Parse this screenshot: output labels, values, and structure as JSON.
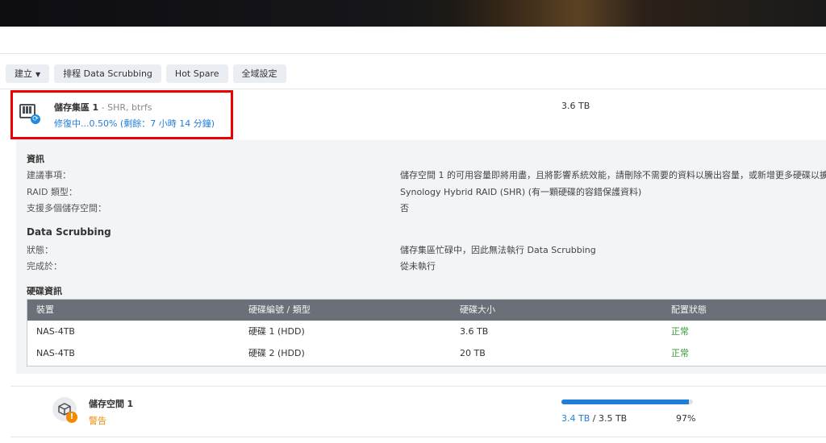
{
  "toolbar": {
    "create_label": "建立",
    "schedule_label": "排程 Data Scrubbing",
    "hotspare_label": "Hot Spare",
    "global_label": "全域設定"
  },
  "pool": {
    "name": "儲存集區",
    "index": "1",
    "fs": " - SHR, btrfs",
    "status": "修復中...0.50% (剩餘：7 小時 14 分鐘)",
    "size": "3.6 TB"
  },
  "info": {
    "title": "資訊",
    "rows": [
      {
        "label": "建議事項：",
        "value": "儲存空間 1 的可用容量即將用盡，且將影響系統效能，請刪除不需要的資料以騰出容量，或新增更多硬碟以擴充"
      },
      {
        "label": "RAID 類型：",
        "value": "Synology Hybrid RAID (SHR) (有一顆硬碟的容錯保護資料)"
      },
      {
        "label": "支援多個儲存空間：",
        "value": "否"
      }
    ]
  },
  "scrubbing": {
    "title": "Data Scrubbing",
    "rows": [
      {
        "label": "狀態：",
        "value": "儲存集區忙碌中，因此無法執行 Data Scrubbing"
      },
      {
        "label": "完成於：",
        "value": "從未執行"
      }
    ]
  },
  "disks": {
    "title": "硬碟資訊",
    "headers": [
      "裝置",
      "硬碟編號 / 類型",
      "硬碟大小",
      "配置狀態"
    ],
    "rows": [
      [
        "NAS-4TB",
        "硬碟 1 (HDD)",
        "3.6 TB",
        "正常"
      ],
      [
        "NAS-4TB",
        "硬碟 2 (HDD)",
        "20 TB",
        "正常"
      ]
    ]
  },
  "volume": {
    "name": "儲存空間",
    "index": "1",
    "status": "警告",
    "used": "3.4 TB",
    "total": " / 3.5 TB",
    "percent_label": "97%",
    "usage_fraction": 0.97
  },
  "icons": {
    "pool": "storage-pool-icon",
    "repair_badge": "sync-icon",
    "volume": "volume-cube-icon",
    "warning_badge": "warning-icon",
    "dropdown": "caret-down-icon"
  },
  "colors": {
    "accent": "#1f7ed8",
    "warning": "#f28b00",
    "ok": "#3a9a3a",
    "highlight": "#ee0000"
  }
}
